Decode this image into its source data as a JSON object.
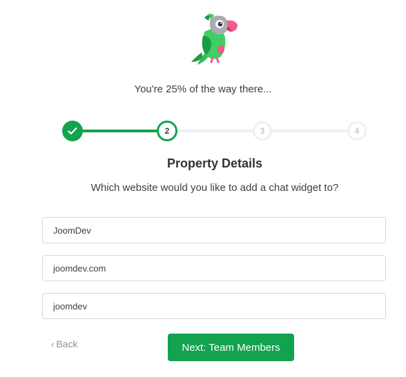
{
  "progress": {
    "text": "You're 25% of the way there...",
    "percent": 25
  },
  "steps": [
    {
      "label": "",
      "state": "complete",
      "icon": "check-icon"
    },
    {
      "label": "2",
      "state": "current"
    },
    {
      "label": "3",
      "state": "pending"
    },
    {
      "label": "4",
      "state": "pending"
    }
  ],
  "section": {
    "title": "Property Details",
    "subtitle": "Which website would you like to add a chat widget to?"
  },
  "form": {
    "property_name": "JoomDev",
    "website_url": "joomdev.com",
    "property_id": "joomdev"
  },
  "actions": {
    "back_label": "Back",
    "next_label": "Next: Team Members"
  },
  "colors": {
    "accent": "#13a24d",
    "inactive": "#eeeff1"
  },
  "icons": {
    "mascot": "parrot-mascot-icon",
    "back": "chevron-left-icon",
    "step_done": "check-icon"
  }
}
